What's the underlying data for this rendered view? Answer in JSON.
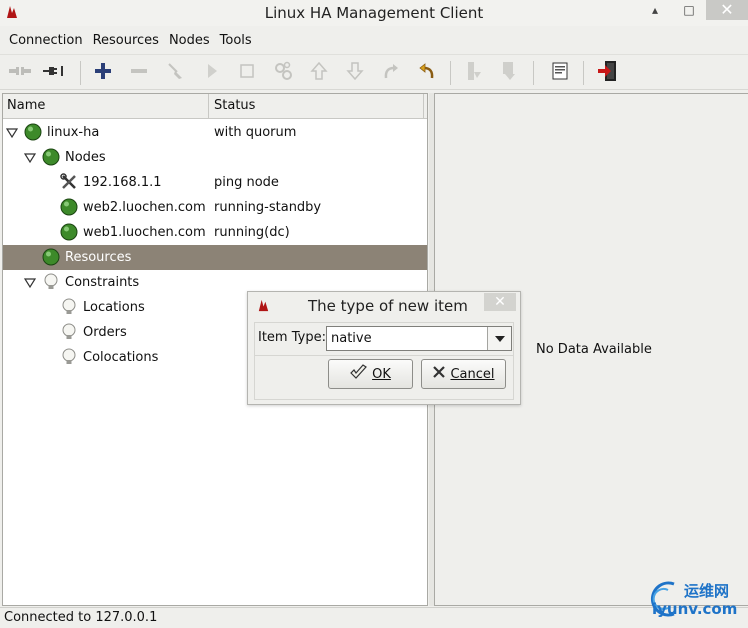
{
  "window": {
    "title": "Linux HA Management Client",
    "minimize": "▴",
    "maximize": "□",
    "close": "✕"
  },
  "menu": [
    "Connection",
    "Resources",
    "Nodes",
    "Tools"
  ],
  "toolbar": {
    "buttons": [
      {
        "name": "disconnect-icon",
        "enabled": false
      },
      {
        "name": "connect-icon",
        "enabled": true
      },
      {
        "name": "add-icon",
        "enabled": true
      },
      {
        "name": "remove-icon",
        "enabled": false
      },
      {
        "name": "cleanup-broom-icon",
        "enabled": false
      },
      {
        "name": "start-icon",
        "enabled": false
      },
      {
        "name": "stop-icon",
        "enabled": false
      },
      {
        "name": "gears-icon",
        "enabled": false
      },
      {
        "name": "move-up-icon",
        "enabled": false
      },
      {
        "name": "move-down-icon",
        "enabled": false
      },
      {
        "name": "redo-icon",
        "enabled": false
      },
      {
        "name": "undo-icon",
        "enabled": true
      },
      {
        "name": "node-standby-icon",
        "enabled": false
      },
      {
        "name": "node-active-icon",
        "enabled": false
      },
      {
        "name": "view-document-icon",
        "enabled": true
      },
      {
        "name": "exit-icon",
        "enabled": true
      }
    ]
  },
  "tree": {
    "headers": {
      "name": "Name",
      "status": "Status"
    },
    "rows": [
      {
        "name": "linux-ha",
        "status": "with quorum",
        "icon": "green-ball",
        "expander": "expanded",
        "level": 0,
        "selected": false
      },
      {
        "name": "Nodes",
        "status": "",
        "icon": "green-ball",
        "expander": "expanded",
        "level": 1,
        "selected": false
      },
      {
        "name": "192.168.1.1",
        "status": "ping node",
        "icon": "tools",
        "expander": "none",
        "level": 2,
        "selected": false
      },
      {
        "name": "web2.luochen.com",
        "status": "running-standby",
        "icon": "green-ball",
        "expander": "none",
        "level": 2,
        "selected": false
      },
      {
        "name": "web1.luochen.com",
        "status": "running(dc)",
        "icon": "green-ball",
        "expander": "none",
        "level": 2,
        "selected": false
      },
      {
        "name": "Resources",
        "status": "",
        "icon": "green-ball",
        "expander": "none",
        "level": 1,
        "selected": true
      },
      {
        "name": "Constraints",
        "status": "",
        "icon": "bulb",
        "expander": "expanded",
        "level": 1,
        "selected": false
      },
      {
        "name": "Locations",
        "status": "",
        "icon": "bulb",
        "expander": "none",
        "level": 2,
        "selected": false
      },
      {
        "name": "Orders",
        "status": "",
        "icon": "bulb",
        "expander": "none",
        "level": 2,
        "selected": false
      },
      {
        "name": "Colocations",
        "status": "",
        "icon": "bulb",
        "expander": "none",
        "level": 2,
        "selected": false
      }
    ]
  },
  "detail": {
    "empty_text": "No Data Available"
  },
  "status_bar": {
    "text": "Connected to 127.0.0.1"
  },
  "dialog": {
    "title": "The type of new item",
    "close": "✕",
    "label": "Item Type:",
    "value": "native",
    "ok_label": "OK",
    "cancel_label": "Cancel"
  },
  "watermark": {
    "line1": "运维网",
    "line2": "iyunv.com"
  },
  "colors": {
    "selected_row": "#8c8376",
    "ball_green": "#3d8a2a",
    "accent_red": "#b01515",
    "watermark_blue": "#1e73c8"
  }
}
